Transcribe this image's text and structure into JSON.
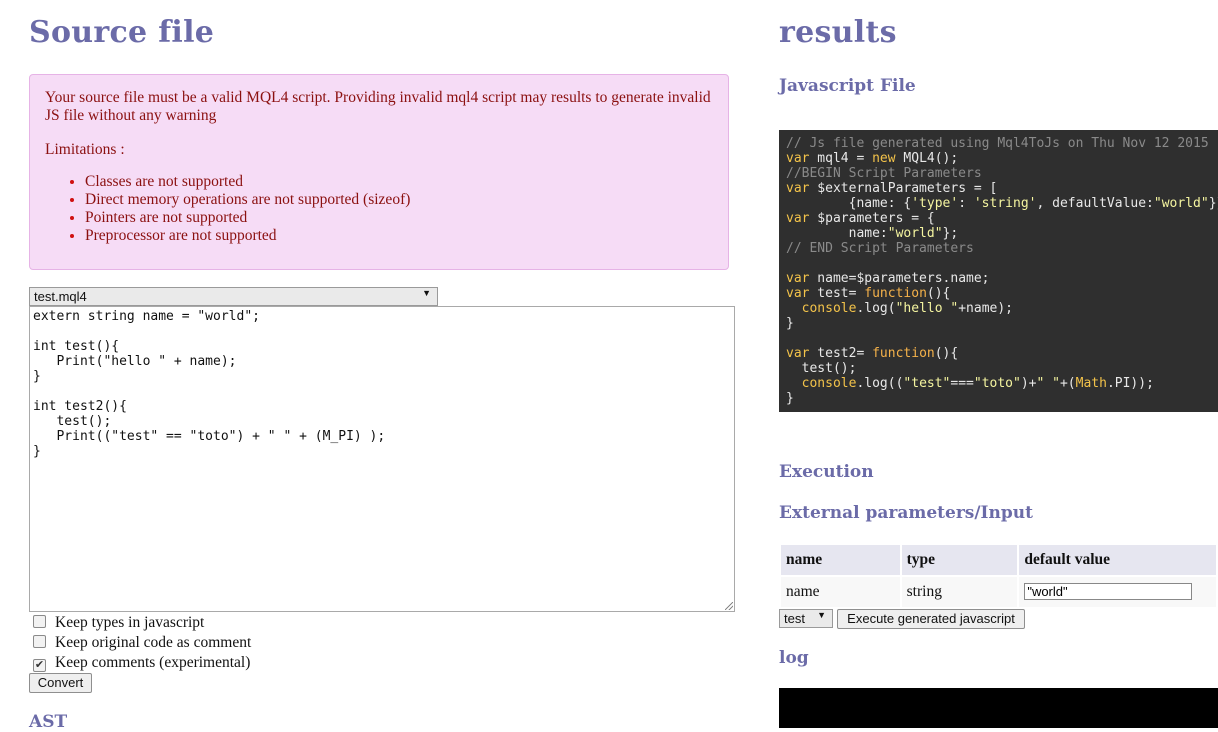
{
  "left": {
    "title": "Source file",
    "notice": {
      "text": "Your source file must be a valid MQL4 script. Providing invalid mql4 script may results to generate invalid JS file without any warning",
      "limitations_label": "Limitations :",
      "items": [
        "Classes are not supported",
        "Direct memory operations are not supported (sizeof)",
        "Pointers are not supported",
        "Preprocessor are not supported"
      ]
    },
    "file_select": "test.mql4",
    "source_code": "extern string name = \"world\";\n\nint test(){\n   Print(\"hello \" + name);\n}\n\nint test2(){\n   test();\n   Print((\"test\" == \"toto\") + \" \" + (M_PI) );\n}",
    "options": [
      {
        "label": "Keep types in javascript",
        "checked": false
      },
      {
        "label": "Keep original code as comment",
        "checked": false
      },
      {
        "label": "Keep comments (experimental)",
        "checked": true
      }
    ],
    "convert_label": "Convert",
    "ast_title": "AST"
  },
  "right": {
    "title": "results",
    "js_title": "Javascript File",
    "execution_title": "Execution",
    "ext_params_title": "External parameters/Input",
    "table": {
      "headers": [
        "name",
        "type",
        "default value"
      ],
      "rows": [
        {
          "name": "name",
          "type": "string",
          "value": "\"world\""
        }
      ]
    },
    "function_select": "test",
    "execute_label": "Execute generated javascript",
    "log_title": "log"
  },
  "colors": {
    "heading": "#6b6ba8",
    "notice_bg": "#f6dcf6",
    "notice_text": "#8b1010",
    "code_bg": "#2f2f2f"
  }
}
